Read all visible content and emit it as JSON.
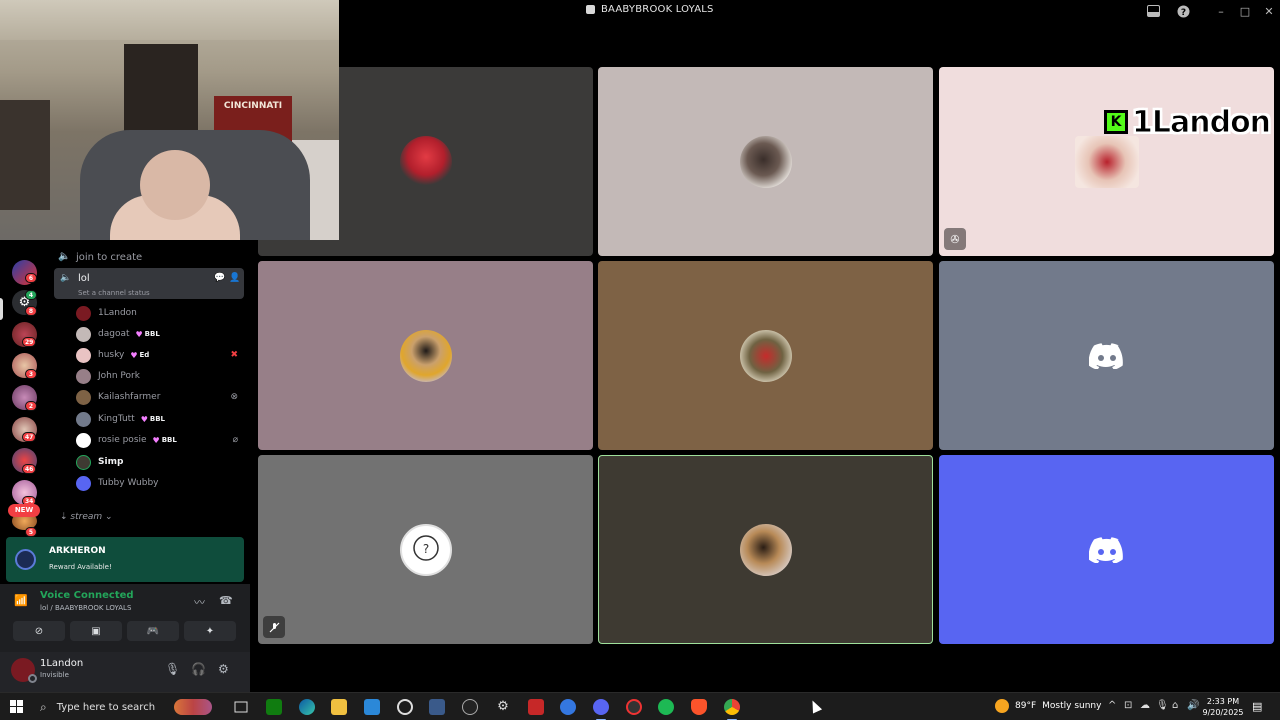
{
  "window": {
    "title": "BAABYBROOK LOYALS"
  },
  "webcam": {
    "banner_text": "CINCINNATI"
  },
  "server_rail": {
    "badges": [
      "6",
      "4",
      "8",
      "29",
      "3",
      "2",
      "47",
      "46",
      "34",
      "5"
    ],
    "new_label": "NEW"
  },
  "channels": {
    "join_to_create": "join to create",
    "active": {
      "name": "lol",
      "status": "Set a channel status"
    },
    "members": [
      {
        "name": "1Landon",
        "tag": ""
      },
      {
        "name": "dagoat",
        "tag": "BBL"
      },
      {
        "name": "husky",
        "tag": "Ed"
      },
      {
        "name": "John Pork",
        "tag": ""
      },
      {
        "name": "Kailashfarmer",
        "tag": ""
      },
      {
        "name": "KingTutt",
        "tag": "BBL"
      },
      {
        "name": "rosie posie",
        "tag": "BBL"
      },
      {
        "name": "Simp",
        "tag": ""
      },
      {
        "name": "Tubby Wubby",
        "tag": ""
      }
    ],
    "category": "stream"
  },
  "reward": {
    "title": "ARKHERON",
    "subtitle": "Reward Available!"
  },
  "voice": {
    "status": "Voice Connected",
    "location": "lol / BAABYBROOK LOYALS"
  },
  "user": {
    "name": "1Landon",
    "status": "Invisible"
  },
  "stage": {
    "overlay_badge": "K",
    "overlay_name": "1Landon"
  },
  "taskbar": {
    "search_placeholder": "Type here to search",
    "weather_temp": "89°F",
    "weather_desc": "Mostly sunny",
    "time": "2:33 PM",
    "date": "9/20/2025"
  },
  "colors": {
    "accent_green": "#23a55a",
    "blurple": "#5865f2",
    "badge_red": "#f23f43"
  }
}
